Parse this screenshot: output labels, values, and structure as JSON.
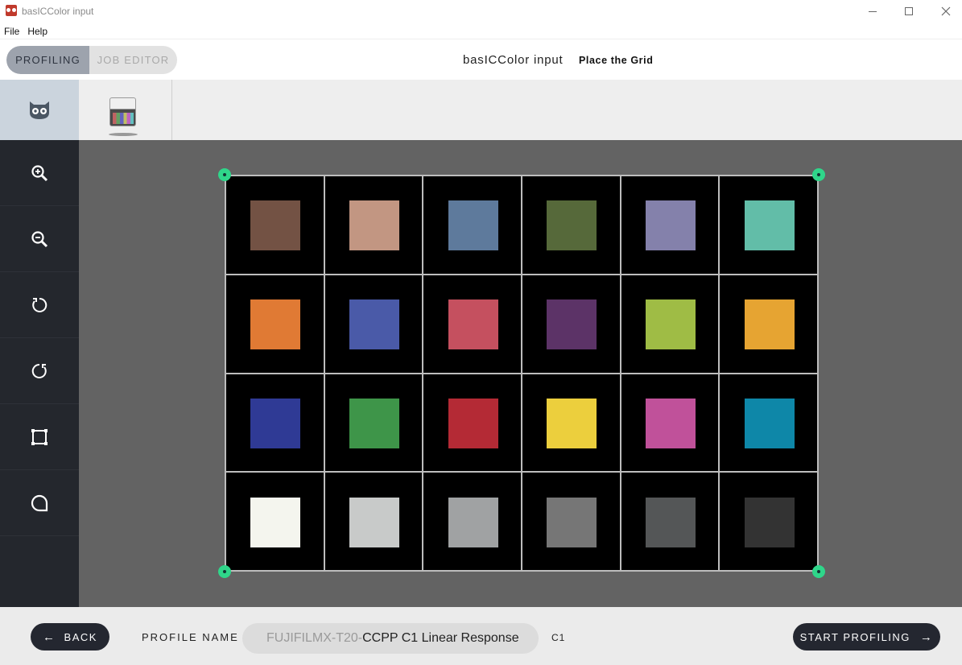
{
  "window": {
    "title": "basICColor input",
    "icon": "app-owl-icon",
    "controls": [
      "minimize",
      "maximize",
      "close"
    ]
  },
  "menu": {
    "items": [
      "File",
      "Help"
    ]
  },
  "header": {
    "segment_active": "PROFILING",
    "segment_inactive": "JOB EDITOR",
    "app_name": "basICColor input",
    "step": "Place the Grid"
  },
  "tabs": [
    {
      "icon": "owl-icon",
      "selected": true
    },
    {
      "icon": "color-chart-icon",
      "selected": false
    }
  ],
  "tools": [
    {
      "icon": "zoom-in-icon"
    },
    {
      "icon": "zoom-out-icon"
    },
    {
      "icon": "rotate-left-icon"
    },
    {
      "icon": "rotate-right-icon"
    },
    {
      "icon": "fit-frame-icon"
    },
    {
      "icon": "actual-size-icon"
    }
  ],
  "grid": {
    "rows": 4,
    "cols": 6,
    "patch_colors": [
      "#735244",
      "#c29682",
      "#5e7a9c",
      "#56693a",
      "#8481ab",
      "#62bda8",
      "#e07a34",
      "#4a5aa8",
      "#c5505f",
      "#5c3367",
      "#9fbc45",
      "#e6a432",
      "#2f3a95",
      "#3e9549",
      "#b42a35",
      "#eccf3d",
      "#c0519a",
      "#0e87a8",
      "#f4f5ee",
      "#c8cac9",
      "#a0a2a3",
      "#767676",
      "#545657",
      "#333333"
    ],
    "handle_color": "#2fd68a"
  },
  "bottom": {
    "back_label": "BACK",
    "profile_name_label": "PROFILE NAME",
    "profile_name_prefix": "FUJIFILMX-T20-",
    "profile_name_value": "CCPP C1 Linear Response",
    "profile_name_suffix": "C1",
    "start_label": "START PROFILING"
  }
}
